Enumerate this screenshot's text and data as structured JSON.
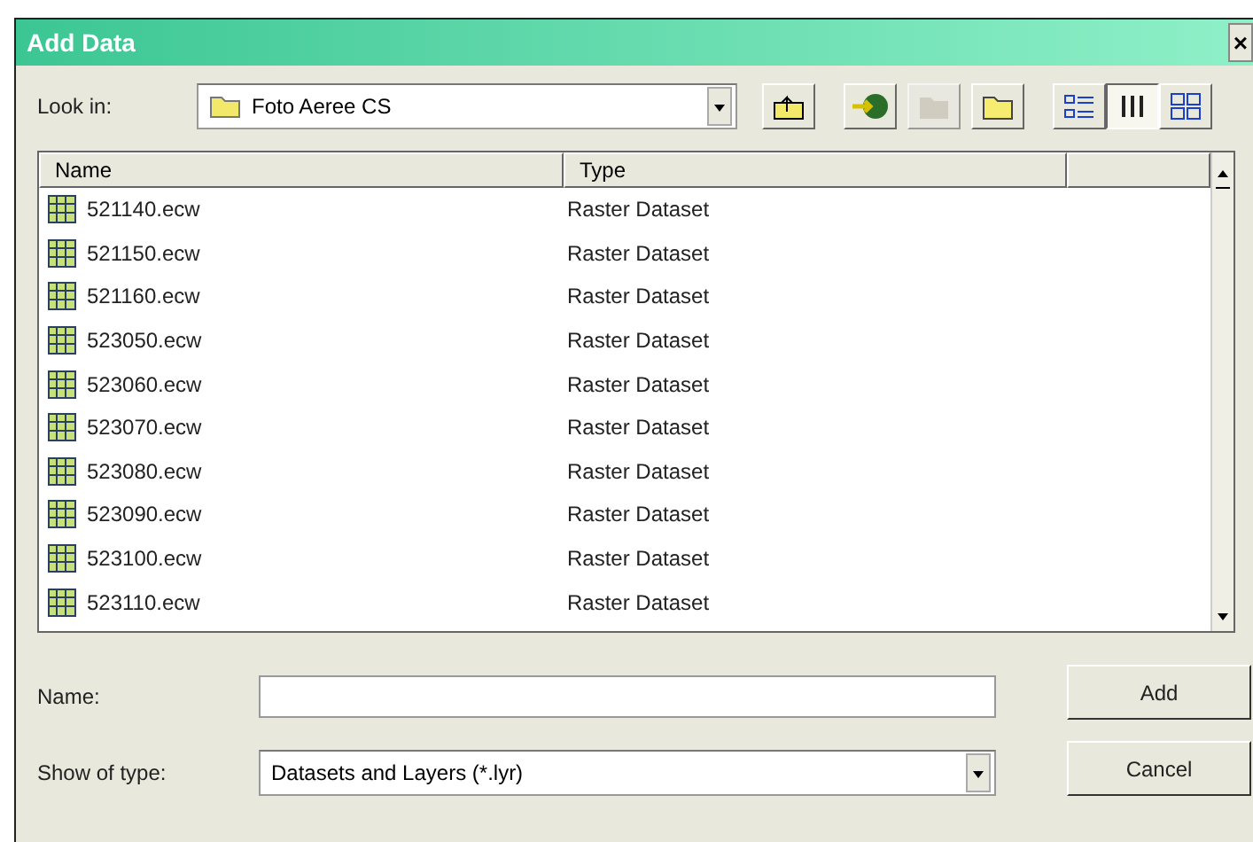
{
  "window": {
    "title": "Add Data",
    "close": "×"
  },
  "look_in": {
    "label": "Look in:",
    "value": "Foto Aeree CS"
  },
  "toolbar": [
    {
      "kind": "up",
      "disabled": false
    },
    {
      "kind": "connect",
      "disabled": false
    },
    {
      "kind": "disconnect",
      "disabled": true
    },
    {
      "kind": "newfolder",
      "disabled": false
    }
  ],
  "views": [
    {
      "kind": "list",
      "selected": false
    },
    {
      "kind": "details",
      "selected": true
    },
    {
      "kind": "thumbnails",
      "selected": false
    }
  ],
  "table": {
    "columns": [
      "Name",
      "Type"
    ],
    "rows": [
      {
        "name": "521140.ecw",
        "type": "Raster Dataset"
      },
      {
        "name": "521150.ecw",
        "type": "Raster Dataset"
      },
      {
        "name": "521160.ecw",
        "type": "Raster Dataset"
      },
      {
        "name": "523050.ecw",
        "type": "Raster Dataset"
      },
      {
        "name": "523060.ecw",
        "type": "Raster Dataset"
      },
      {
        "name": "523070.ecw",
        "type": "Raster Dataset"
      },
      {
        "name": "523080.ecw",
        "type": "Raster Dataset"
      },
      {
        "name": "523090.ecw",
        "type": "Raster Dataset"
      },
      {
        "name": "523100.ecw",
        "type": "Raster Dataset"
      },
      {
        "name": "523110.ecw",
        "type": "Raster Dataset"
      }
    ]
  },
  "name_field": {
    "label": "Name:"
  },
  "type_field": {
    "label": "Show of type:",
    "value": "Datasets and Layers (*.lyr)"
  },
  "buttons": [
    "Add",
    "Cancel"
  ]
}
